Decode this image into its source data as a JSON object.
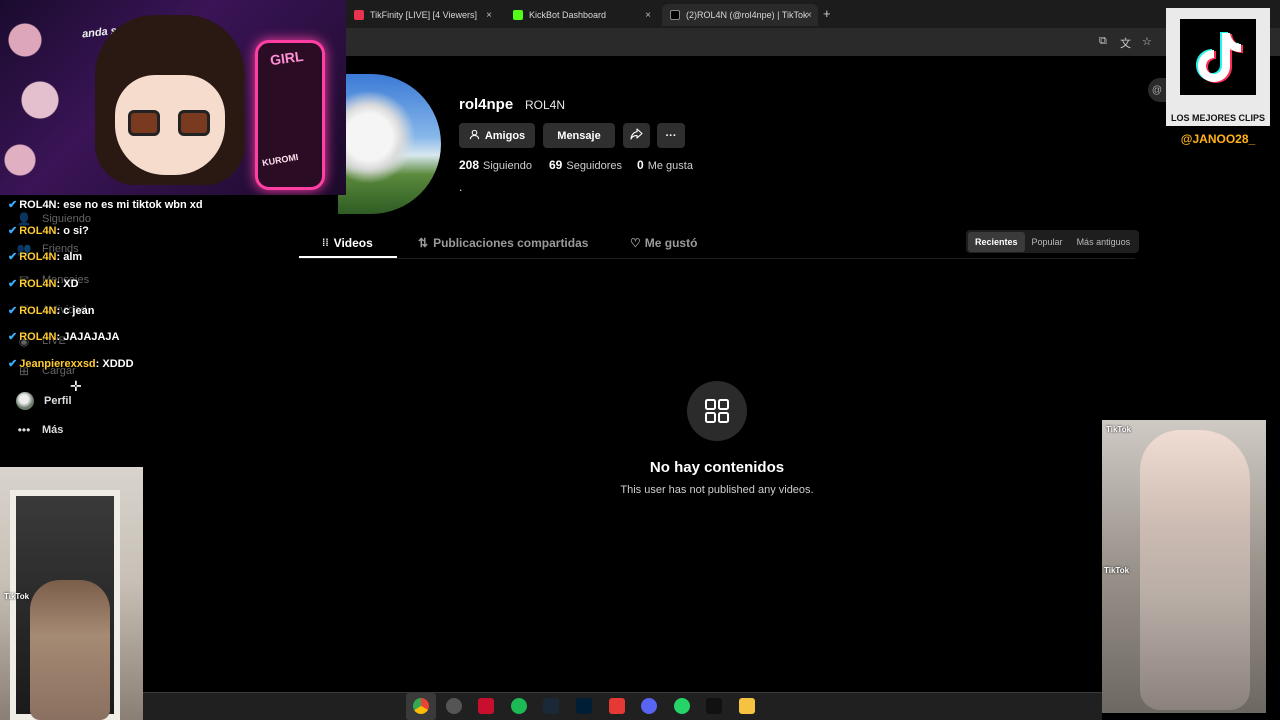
{
  "browser": {
    "tabs": [
      {
        "label": "TikFinity [LIVE] [4 Viewers]",
        "icon_color": "#e8344e",
        "close": "×"
      },
      {
        "label": "KickBot Dashboard",
        "icon_color": "#53fc18",
        "close": "×"
      },
      {
        "label": "(2)ROL4N (@rol4npe) | TikTok",
        "icon_color": "#000000",
        "close": "×",
        "active": true
      }
    ],
    "new_tab": "+",
    "toolbar_icons": [
      "install-icon",
      "translate-icon",
      "star-icon"
    ]
  },
  "profile": {
    "username": "rol4npe",
    "nickname": "ROL4N",
    "friends_label": "Amigos",
    "message_label": "Mensaje",
    "share_icon": "share-icon",
    "more_label": "···",
    "stats": {
      "following_count": "208",
      "following_label": "Siguiendo",
      "followers_count": "69",
      "followers_label": "Seguidores",
      "likes_count": "0",
      "likes_label": "Me gusta"
    },
    "bio": ".",
    "tabs": {
      "videos": "Videos",
      "reposts": "Publicaciones compartidas",
      "liked": "Me gustó"
    },
    "sort": {
      "recent": "Recientes",
      "popular": "Popular",
      "oldest": "Más antiguos"
    },
    "empty": {
      "title": "No hay contenidos",
      "subtitle": "This user has not published any videos."
    }
  },
  "sidebar": {
    "items": [
      {
        "label": "Siguiendo",
        "icon": "following-icon"
      },
      {
        "label": "Friends",
        "icon": "friends-icon"
      },
      {
        "label": "Mensajes",
        "icon": "messages-icon"
      },
      {
        "label": "Actividad",
        "icon": "activity-icon"
      },
      {
        "label": "LIVE",
        "icon": "live-icon"
      },
      {
        "label": "Cargar",
        "icon": "upload-icon"
      },
      {
        "label": "Perfil",
        "icon": "profile-avatar"
      },
      {
        "label": "Más",
        "icon": "more-icon"
      }
    ]
  },
  "chat": [
    {
      "user": "ROL4N",
      "message": "ese no es mi tiktok wbn xd"
    },
    {
      "user": "ROL4N",
      "message": "o si?"
    },
    {
      "user": "ROL4N",
      "message": "alm"
    },
    {
      "user": "ROL4N",
      "message": "XD"
    },
    {
      "user": "ROL4N",
      "message": "c jean"
    },
    {
      "user": "ROL4N",
      "message": "JAJAJAJA"
    },
    {
      "user": "Jeanpierexxsd",
      "message": "XDDD"
    }
  ],
  "overlay": {
    "chair_text": "anda sen",
    "sign_text": "GIRL",
    "sign_bottom": "KUROMI",
    "clips_label": "LOS MEJORES CLIPS",
    "clips_handle": "@JANOO28_",
    "watermark": "TikTok"
  },
  "taskbar": {
    "apps": [
      {
        "name": "chrome-icon",
        "color": "#4285f4"
      },
      {
        "name": "obs-icon",
        "color": "#555555"
      },
      {
        "name": "vpn-icon",
        "color": "#c8102e"
      },
      {
        "name": "spotify-icon",
        "color": "#1db954"
      },
      {
        "name": "steam-icon",
        "color": "#1b2838"
      },
      {
        "name": "photoshop-icon",
        "color": "#001e36"
      },
      {
        "name": "record-icon",
        "color": "#e53935"
      },
      {
        "name": "discord-icon",
        "color": "#5865f2"
      },
      {
        "name": "whatsapp-icon",
        "color": "#25d366"
      },
      {
        "name": "tiktok-icon",
        "color": "#111111"
      },
      {
        "name": "file-explorer-icon",
        "color": "#f5c242"
      }
    ]
  },
  "colors": {
    "accent_yellow": "#ffb21a",
    "chat_user": "#ffcc33",
    "chat_check": "#3ab0ff"
  }
}
